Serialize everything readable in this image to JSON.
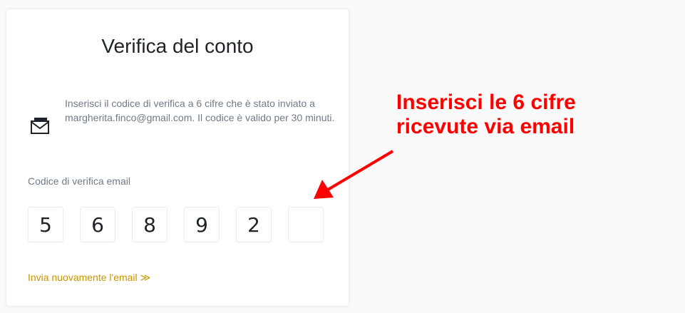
{
  "card": {
    "title": "Verifica del conto",
    "info_text": "Inserisci il codice di verifica a 6 cifre che è stato inviato a margherita.finco@gmail.com. Il codice è valido per 30 minuti.",
    "code_label": "Codice di verifica email",
    "code_digits": [
      "5",
      "6",
      "8",
      "9",
      "2",
      ""
    ],
    "resend_label": "Invia nuovamente l'email ≫"
  },
  "annotation": {
    "line1": "Inserisci le 6 cifre",
    "line2": "ricevute via email"
  },
  "colors": {
    "accent": "#c99400",
    "annotation": "#ff0000",
    "text_primary": "#1e2329",
    "text_secondary": "#707a8a"
  }
}
